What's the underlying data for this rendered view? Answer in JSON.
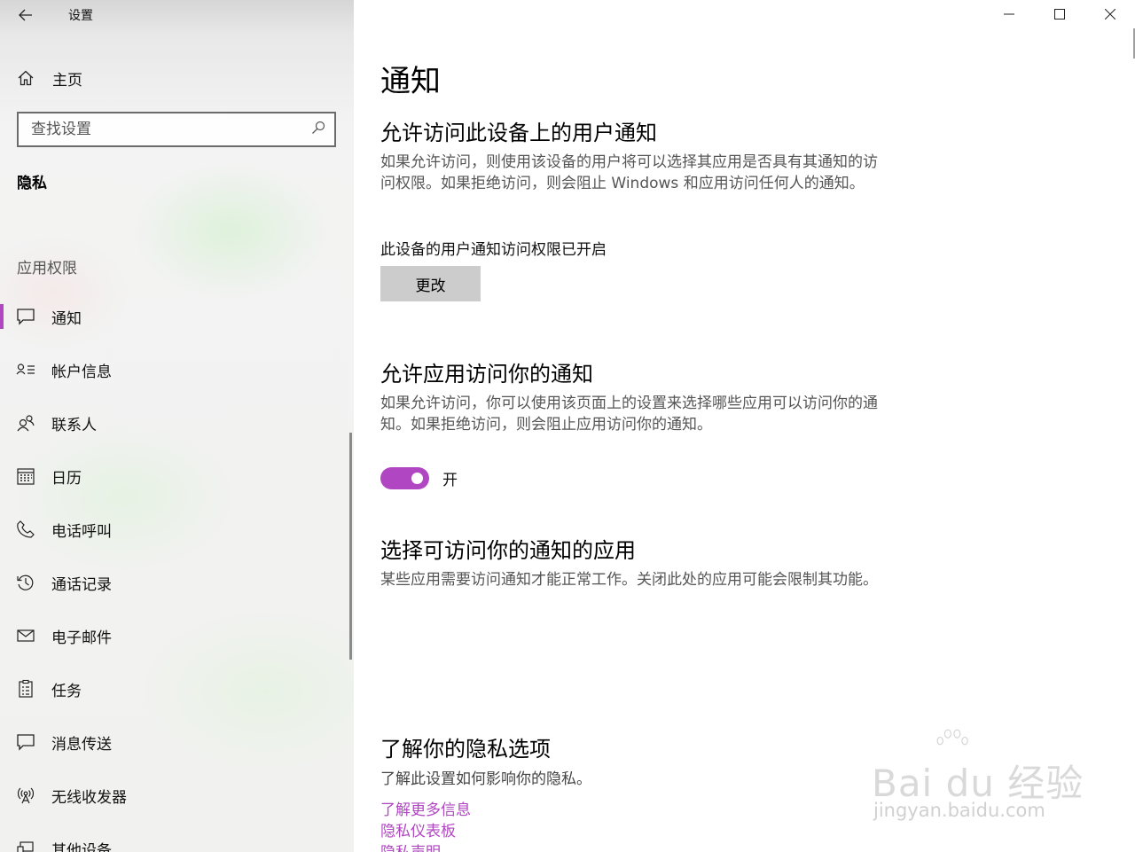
{
  "window": {
    "title": "设置",
    "controls": [
      "minimize-icon",
      "maximize-icon",
      "close-icon"
    ]
  },
  "sidebar": {
    "home_label": "主页",
    "search": {
      "placeholder": "查找设置",
      "value": ""
    },
    "section_title": "隐私",
    "group_header": "应用权限",
    "items": [
      {
        "label": "通知",
        "icon": "notification-icon",
        "active": true
      },
      {
        "label": "帐户信息",
        "icon": "account-info-icon",
        "active": false
      },
      {
        "label": "联系人",
        "icon": "contacts-icon",
        "active": false
      },
      {
        "label": "日历",
        "icon": "calendar-icon",
        "active": false
      },
      {
        "label": "电话呼叫",
        "icon": "phone-icon",
        "active": false
      },
      {
        "label": "通话记录",
        "icon": "call-history-icon",
        "active": false
      },
      {
        "label": "电子邮件",
        "icon": "email-icon",
        "active": false
      },
      {
        "label": "任务",
        "icon": "tasks-icon",
        "active": false
      },
      {
        "label": "消息传送",
        "icon": "messaging-icon",
        "active": false
      },
      {
        "label": "无线收发器",
        "icon": "radio-icon",
        "active": false
      },
      {
        "label": "其他设备",
        "icon": "other-devices-icon",
        "active": false
      }
    ]
  },
  "main": {
    "title": "通知",
    "section1": {
      "heading": "允许访问此设备上的用户通知",
      "description": "如果允许访问，则使用该设备的用户将可以选择其应用是否具有其通知的访问权限。如果拒绝访问，则会阻止 Windows 和应用访问任何人的通知。",
      "status": "此设备的用户通知访问权限已开启",
      "change_button": "更改"
    },
    "section2": {
      "heading": "允许应用访问你的通知",
      "description": "如果允许访问，你可以使用该页面上的设置来选择哪些应用可以访问你的通知。如果拒绝访问，则会阻止应用访问你的通知。",
      "toggle_label": "开",
      "toggle_on": true
    },
    "section3": {
      "heading": "选择可访问你的通知的应用",
      "description": "某些应用需要访问通知才能正常工作。关闭此处的应用可能会限制其功能。"
    },
    "section4": {
      "heading": "了解你的隐私选项",
      "description": "了解此设置如何影响你的隐私。",
      "links": [
        "了解更多信息",
        "隐私仪表板",
        "隐私声明"
      ]
    }
  },
  "watermark": {
    "brand": "Bai du 经验",
    "url": "jingyan.baidu.com"
  },
  "colors": {
    "accent": "#b146c2",
    "sidebar_bg": "#f1f2ef",
    "button_bg": "#cccccc",
    "secondary_text": "#555555"
  }
}
